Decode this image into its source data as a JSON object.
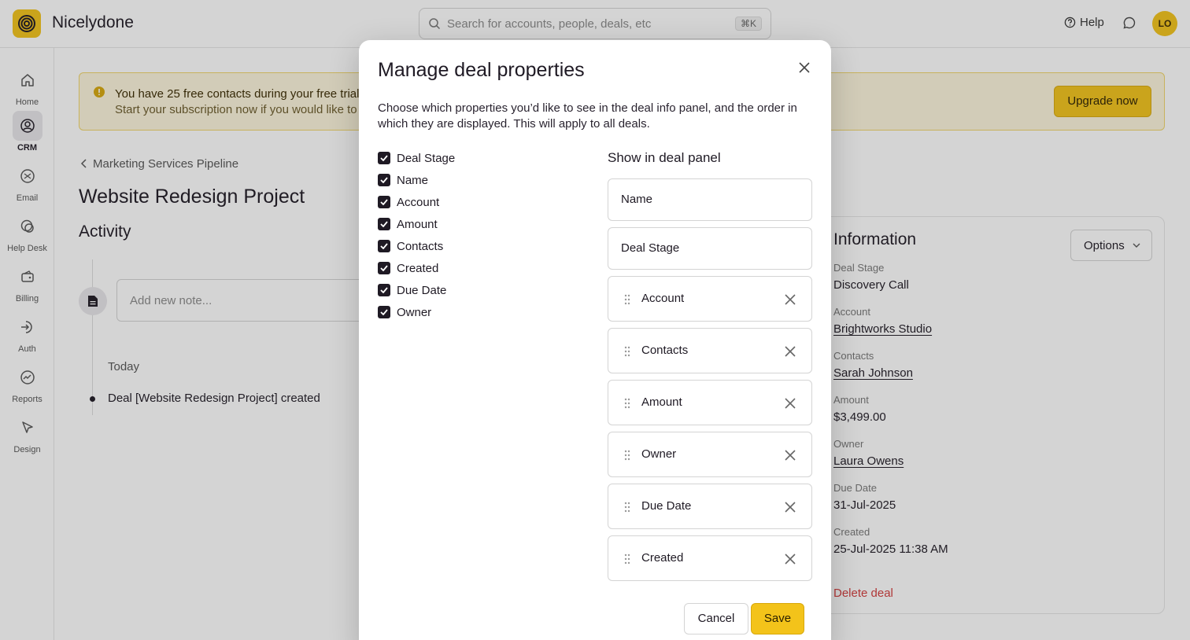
{
  "app": {
    "brand": "Nicelydone"
  },
  "header": {
    "search_placeholder": "Search for accounts, people, deals, etc",
    "search_shortcut": "⌘K",
    "help_label": "Help",
    "avatar_initials": "LO"
  },
  "sidebar": {
    "items": [
      {
        "label": "Home",
        "icon": "home-icon"
      },
      {
        "label": "CRM",
        "icon": "crm-icon",
        "active": true
      },
      {
        "label": "Email",
        "icon": "email-icon"
      },
      {
        "label": "Help Desk",
        "icon": "help-desk-icon"
      },
      {
        "label": "Billing",
        "icon": "billing-icon"
      },
      {
        "label": "Auth",
        "icon": "auth-icon"
      },
      {
        "label": "Reports",
        "icon": "reports-icon"
      },
      {
        "label": "Design",
        "icon": "design-icon"
      }
    ]
  },
  "banner": {
    "line1": "You have 25 free contacts during your free trial",
    "line2": "Start your subscription now if you would like to i",
    "upgrade_label": "Upgrade now"
  },
  "deal": {
    "breadcrumb": "Marketing Services Pipeline",
    "title": "Website Redesign Project",
    "activity_title": "Activity",
    "note_placeholder": "Add new note...",
    "today_label": "Today",
    "event": "Deal [Website Redesign Project] created"
  },
  "info": {
    "title": "Information",
    "options_label": "Options",
    "fields": [
      {
        "label": "Deal Stage",
        "value": "Discovery Call",
        "link": false
      },
      {
        "label": "Account",
        "value": "Brightworks Studio",
        "link": true
      },
      {
        "label": "Contacts",
        "value": "Sarah Johnson",
        "link": true
      },
      {
        "label": "Amount",
        "value": "$3,499.00",
        "link": false
      },
      {
        "label": "Owner",
        "value": "Laura Owens",
        "link": true
      },
      {
        "label": "Due Date",
        "value": "31-Jul-2025",
        "link": false
      },
      {
        "label": "Created",
        "value": "25-Jul-2025 11:38 AM",
        "link": false
      }
    ],
    "delete_label": "Delete deal"
  },
  "modal": {
    "title": "Manage deal properties",
    "description": "Choose which properties you’d like to see in the deal info panel, and the order in which they are displayed. This will apply to all deals.",
    "checkboxes": [
      {
        "label": "Deal Stage",
        "checked": true
      },
      {
        "label": "Name",
        "checked": true
      },
      {
        "label": "Account",
        "checked": true
      },
      {
        "label": "Amount",
        "checked": true
      },
      {
        "label": "Contacts",
        "checked": true
      },
      {
        "label": "Created",
        "checked": true
      },
      {
        "label": "Due Date",
        "checked": true
      },
      {
        "label": "Owner",
        "checked": true
      }
    ],
    "panel_title": "Show in deal panel",
    "fixed_slots": [
      "Name",
      "Deal Stage"
    ],
    "draggable_slots": [
      "Account",
      "Contacts",
      "Amount",
      "Owner",
      "Due Date",
      "Created"
    ],
    "cancel_label": "Cancel",
    "save_label": "Save"
  },
  "colors": {
    "accent": "#f3c31a",
    "danger": "#d23b3b",
    "dark": "#1f1a24"
  }
}
